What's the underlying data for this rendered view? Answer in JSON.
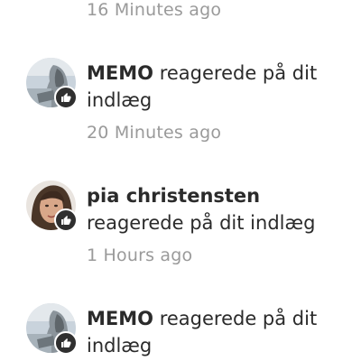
{
  "notifications": [
    {
      "time": "16 Minutes ago"
    },
    {
      "name": "MEMO",
      "action": "reagerede på dit indlæg",
      "time": "20 Minutes ago",
      "avatar_icon": "user-photo-memo",
      "badge_icon": "thumbs-up-icon"
    },
    {
      "name": "pia christensten",
      "action": "reagerede på dit indlæg",
      "time": "1 Hours ago",
      "avatar_icon": "user-photo-pia",
      "badge_icon": "thumbs-up-icon"
    },
    {
      "name": "MEMO",
      "action": "reagerede på dit indlæg",
      "avatar_icon": "user-photo-memo",
      "badge_icon": "thumbs-up-icon"
    }
  ],
  "colors": {
    "text": "#2b2b2b",
    "muted": "#9a9a9a",
    "badge": "#2f2f2f"
  }
}
